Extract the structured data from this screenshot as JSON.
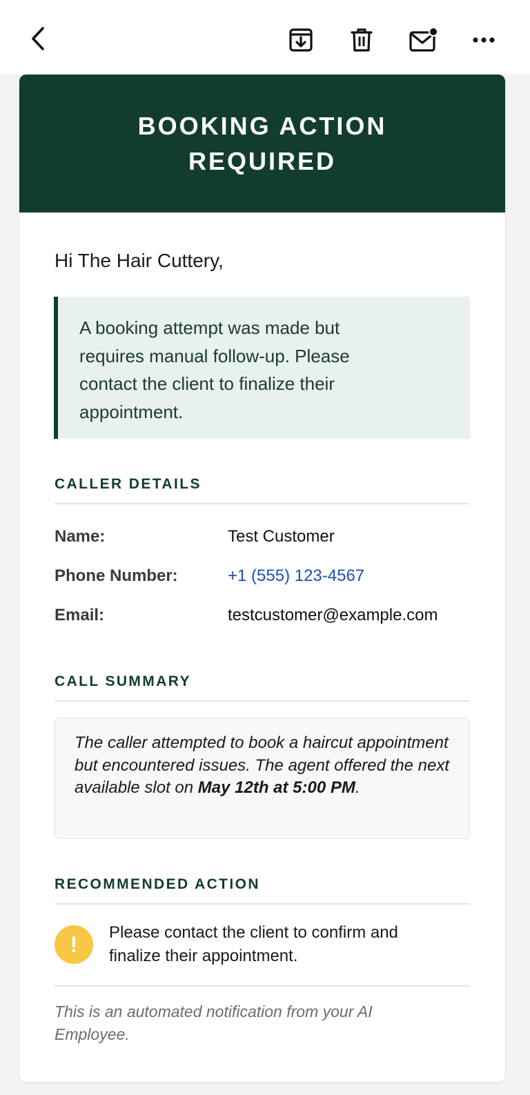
{
  "toolbar": {
    "back_icon": "chevron-left-icon",
    "archive_icon": "archive-icon",
    "delete_icon": "trash-icon",
    "unread_icon": "mail-unread-icon",
    "more_icon": "more-horizontal-icon"
  },
  "email": {
    "banner_title": "BOOKING ACTION REQUIRED",
    "greeting": "Hi The Hair Cuttery,",
    "alert_text": "A booking attempt was made but requires manual follow-up. Please contact the client to finalize their appointment.",
    "caller_details": {
      "heading": "CALLER DETAILS",
      "rows": [
        {
          "label": "Name:",
          "value": "Test Customer"
        },
        {
          "label": "Phone Number:",
          "value": "+1 (555) 123-4567"
        },
        {
          "label": "Email:",
          "value": "testcustomer@example.com"
        }
      ]
    },
    "call_summary": {
      "heading": "CALL SUMMARY",
      "text": "The caller attempted to book a haircut appointment but encountered issues. The agent offered the next available slot on",
      "emphasis": "May 12th at 5:00 PM",
      "suffix": "."
    },
    "recommended_action": {
      "heading": "RECOMMENDED ACTION",
      "icon": "exclamation-icon",
      "icon_glyph": "!",
      "text": "Please contact the client to confirm and finalize their appointment."
    },
    "footer": "This is an automated notification from your AI Employee."
  },
  "colors": {
    "brand_green": "#123d2c",
    "alert_background": "#e8f1ee",
    "link_blue": "#1a4fb8",
    "warning_yellow": "#f7c745"
  }
}
